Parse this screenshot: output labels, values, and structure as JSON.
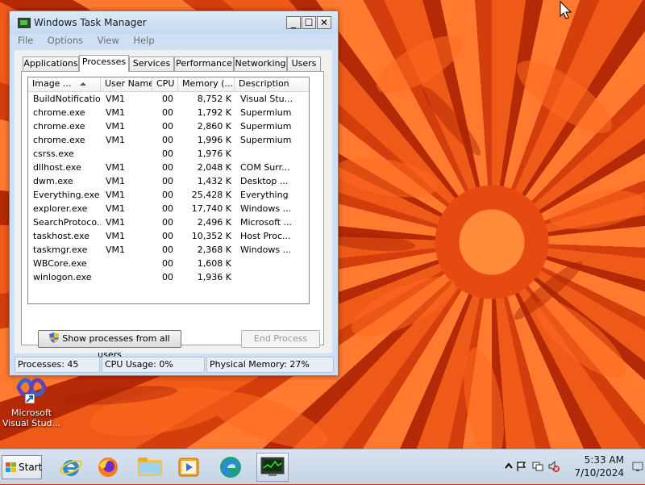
{
  "window": {
    "title": "Windows Task Manager",
    "minimize_label": "_",
    "maximize_label": "☐",
    "close_label": "✕"
  },
  "menu": [
    "File",
    "Options",
    "View",
    "Help"
  ],
  "tabs": [
    "Applications",
    "Processes",
    "Services",
    "Performance",
    "Networking",
    "Users"
  ],
  "active_tab": "Processes",
  "table": {
    "columns": [
      "Image ...",
      "User Name",
      "CPU",
      "Memory (...",
      "Description"
    ],
    "rows": [
      {
        "image": "BuildNotificatio...",
        "user": "VM1",
        "cpu": "00",
        "memory": "8,752 K",
        "desc": "Visual Stu..."
      },
      {
        "image": "chrome.exe",
        "user": "VM1",
        "cpu": "00",
        "memory": "1,792 K",
        "desc": "Supermium"
      },
      {
        "image": "chrome.exe",
        "user": "VM1",
        "cpu": "00",
        "memory": "2,860 K",
        "desc": "Supermium"
      },
      {
        "image": "chrome.exe",
        "user": "VM1",
        "cpu": "00",
        "memory": "1,996 K",
        "desc": "Supermium"
      },
      {
        "image": "csrss.exe",
        "user": "",
        "cpu": "00",
        "memory": "1,976 K",
        "desc": ""
      },
      {
        "image": "dllhost.exe",
        "user": "VM1",
        "cpu": "00",
        "memory": "2,048 K",
        "desc": "COM Surr..."
      },
      {
        "image": "dwm.exe",
        "user": "VM1",
        "cpu": "00",
        "memory": "1,432 K",
        "desc": "Desktop ..."
      },
      {
        "image": "Everything.exe",
        "user": "VM1",
        "cpu": "00",
        "memory": "25,428 K",
        "desc": "Everything"
      },
      {
        "image": "explorer.exe",
        "user": "VM1",
        "cpu": "00",
        "memory": "17,740 K",
        "desc": "Windows ..."
      },
      {
        "image": "SearchProtoco...",
        "user": "VM1",
        "cpu": "00",
        "memory": "2,496 K",
        "desc": "Microsoft ..."
      },
      {
        "image": "taskhost.exe",
        "user": "VM1",
        "cpu": "00",
        "memory": "10,352 K",
        "desc": "Host Proc..."
      },
      {
        "image": "taskmgr.exe",
        "user": "VM1",
        "cpu": "00",
        "memory": "2,368 K",
        "desc": "Windows ..."
      },
      {
        "image": "WBCore.exe",
        "user": "",
        "cpu": "00",
        "memory": "1,608 K",
        "desc": ""
      },
      {
        "image": "winlogon.exe",
        "user": "",
        "cpu": "00",
        "memory": "1,936 K",
        "desc": ""
      }
    ]
  },
  "buttons": {
    "show_all": "Show processes from all users",
    "end_process": "End Process"
  },
  "status": {
    "processes": "Processes: 45",
    "cpu": "CPU Usage: 0%",
    "memory": "Physical Memory: 27%"
  },
  "desktop_icon": {
    "label": "Microsoft Visual Stud...",
    "icon": "visual-studio-icon"
  },
  "taskbar": {
    "start_label": "Start",
    "apps": [
      "internet-explorer-icon",
      "firefox-icon",
      "file-explorer-icon",
      "media-player-icon",
      "edge-icon",
      "task-manager-icon"
    ],
    "time": "5:33 AM",
    "date": "7/10/2024"
  }
}
